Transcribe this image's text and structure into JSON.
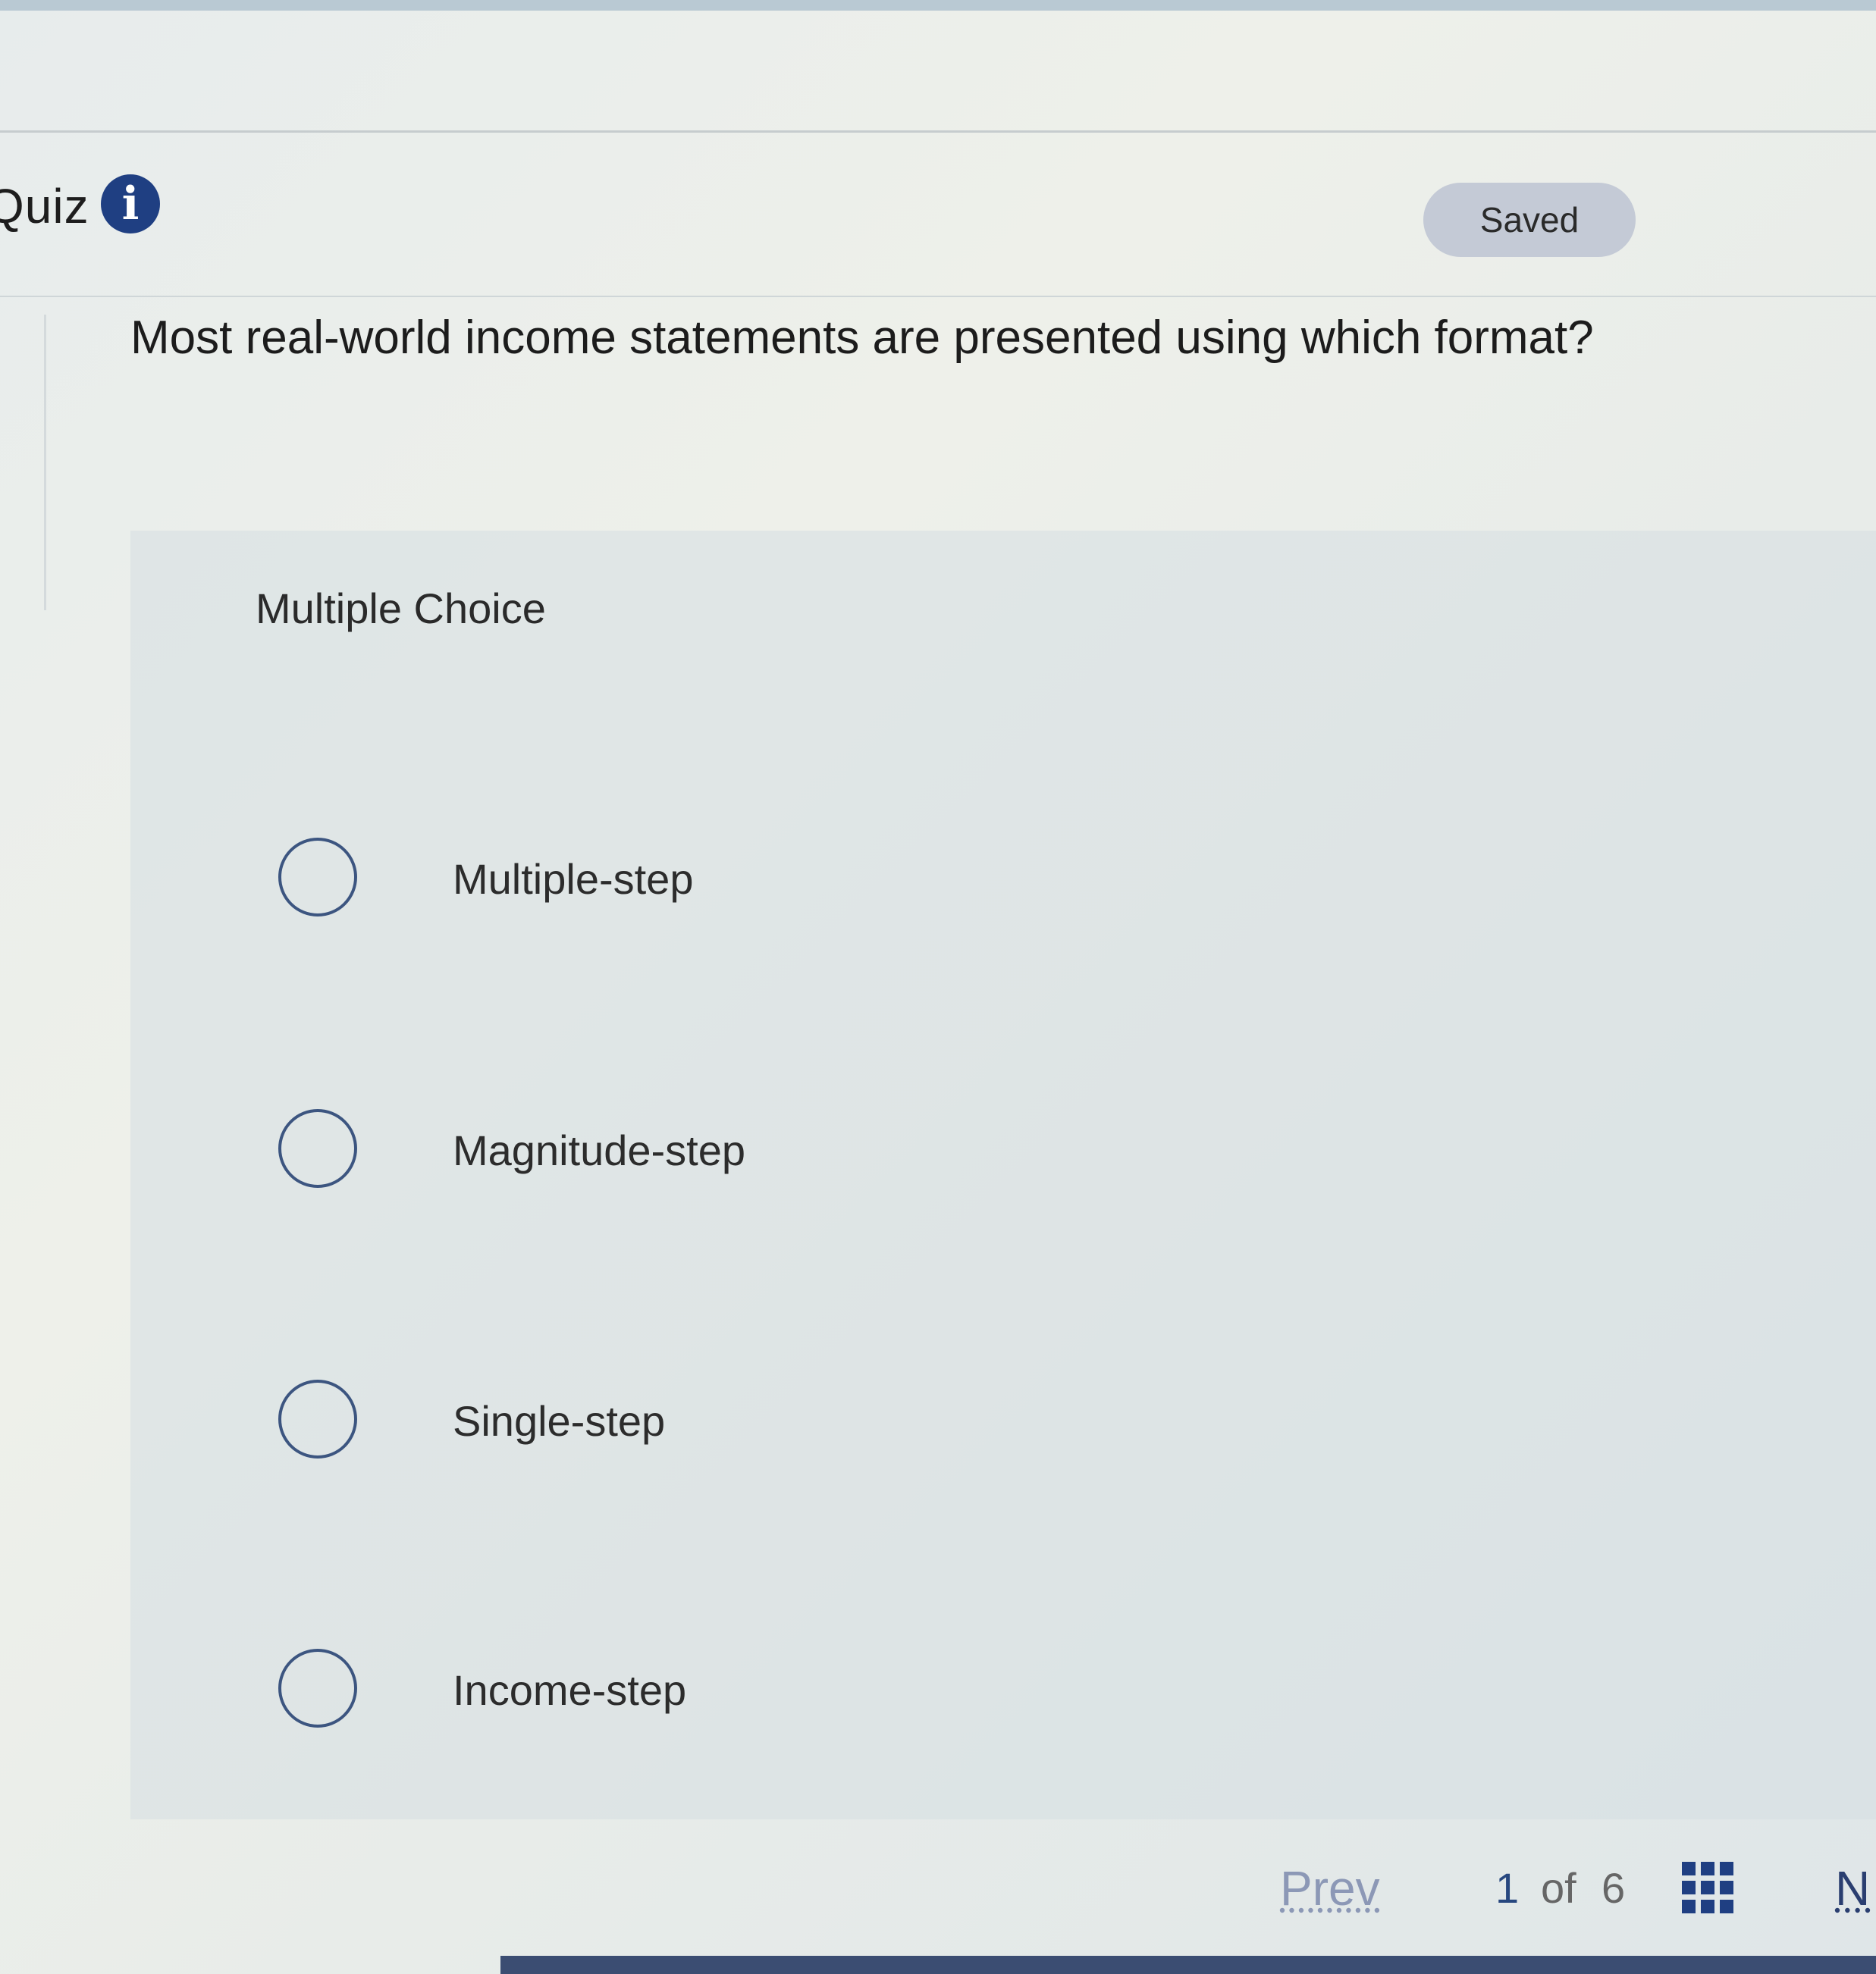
{
  "header": {
    "title": "Quiz",
    "info_icon": "info-icon",
    "saved_label": "Saved"
  },
  "question": {
    "text": "Most real-world income statements are presented using which format?",
    "type_label": "Multiple Choice",
    "options": [
      {
        "label": "Multiple-step",
        "selected": false
      },
      {
        "label": "Magnitude-step",
        "selected": false
      },
      {
        "label": "Single-step",
        "selected": false
      },
      {
        "label": "Income-step",
        "selected": false
      }
    ]
  },
  "footer": {
    "prev_label": "Prev",
    "current_page": "1",
    "of_label": "of",
    "total_pages": "6",
    "grid_icon": "grid-icon",
    "next_label": "N"
  },
  "colors": {
    "accent": "#1f3f82",
    "saved_badge_bg": "#c4cad6",
    "radio_border": "#3c5580"
  }
}
